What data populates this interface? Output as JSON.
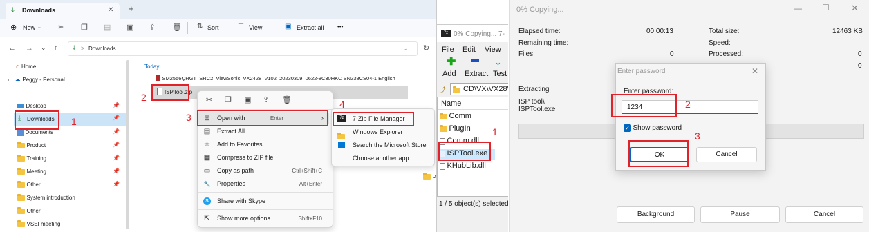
{
  "explorer": {
    "tab_title": "Downloads",
    "tab_close": "✕",
    "new_tab": "+",
    "toolbar": {
      "new": "New",
      "sort": "Sort",
      "view": "View",
      "extract_all": "Extract all",
      "more": "•••"
    },
    "address": "Downloads",
    "address_sep": ">",
    "sidebar": [
      {
        "label": "Home"
      },
      {
        "label": "Peggy - Personal"
      },
      {
        "label": "Desktop"
      },
      {
        "label": "Downloads"
      },
      {
        "label": "Documents"
      },
      {
        "label": "Product"
      },
      {
        "label": "Training"
      },
      {
        "label": "Meeting"
      },
      {
        "label": "Other"
      },
      {
        "label": "System introduction"
      },
      {
        "label": "Other"
      },
      {
        "label": "VSEI meeting"
      }
    ],
    "group_header": "Today",
    "file1": "SM2556QRGT_SRC2_ViewSonic_VX2428_V102_20230309_0622-8C30HKC SN238CS04-1 English",
    "file2": "ISPTool.zip",
    "right_folder": "D",
    "context_menu": [
      {
        "label": "Open with",
        "shortcut": "Enter",
        "icon": "⊞"
      },
      {
        "label": "Extract All...",
        "shortcut": "",
        "icon": "▤"
      },
      {
        "label": "Add to Favorites",
        "shortcut": "",
        "icon": "☆"
      },
      {
        "label": "Compress to ZIP file",
        "shortcut": "",
        "icon": "▦"
      },
      {
        "label": "Copy as path",
        "shortcut": "Ctrl+Shift+C",
        "icon": "▭"
      },
      {
        "label": "Properties",
        "shortcut": "Alt+Enter",
        "icon": "🔧"
      },
      {
        "label": "Share with Skype",
        "shortcut": "",
        "icon": "S"
      },
      {
        "label": "Show more options",
        "shortcut": "Shift+F10",
        "icon": "⇱"
      }
    ],
    "submenu": [
      {
        "label": "7-Zip File Manager"
      },
      {
        "label": "Windows Explorer"
      },
      {
        "label": "Search the Microsoft Store"
      },
      {
        "label": "Choose another app"
      }
    ],
    "annotations": [
      "1",
      "2",
      "3",
      "4"
    ]
  },
  "zipfm": {
    "title": "0% Copying... 7-",
    "menu": [
      "File",
      "Edit",
      "View"
    ],
    "tools": [
      "Add",
      "Extract",
      "Test"
    ],
    "path": "CD\\VX\\VX28\\",
    "column": "Name",
    "files": [
      "Comm",
      "PlugIn",
      "Comm.dll",
      "ISPTool.exe",
      "KHubLib.dll"
    ],
    "status": "1 / 5 object(s) selected",
    "annotation": "1"
  },
  "progress": {
    "title": "0% Copying...",
    "elapsed_label": "Elapsed time:",
    "elapsed_value": "00:00:13",
    "remaining_label": "Remaining time:",
    "files_label": "Files:",
    "files_value": "0",
    "total_label": "Total size:",
    "total_value": "12463 KB",
    "speed_label": "Speed:",
    "processed_label": "Processed:",
    "processed_value": "0",
    "extra_value": "0",
    "extracting_label": "Extracting",
    "path_line1": "ISP tool\\",
    "path_line2": "ISPTool.exe",
    "buttons": {
      "background": "Background",
      "pause": "Pause",
      "cancel": "Cancel"
    }
  },
  "password_dialog": {
    "title": "Enter password",
    "label": "Enter password:",
    "value": "1234",
    "show_password": "Show password",
    "ok": "OK",
    "cancel": "Cancel",
    "annotations": [
      "2",
      "3"
    ]
  },
  "colors": {
    "accent": "#0067c0",
    "annotation_red": "#e0232b",
    "folder": "#f4c542",
    "selection": "#cce8ff"
  }
}
